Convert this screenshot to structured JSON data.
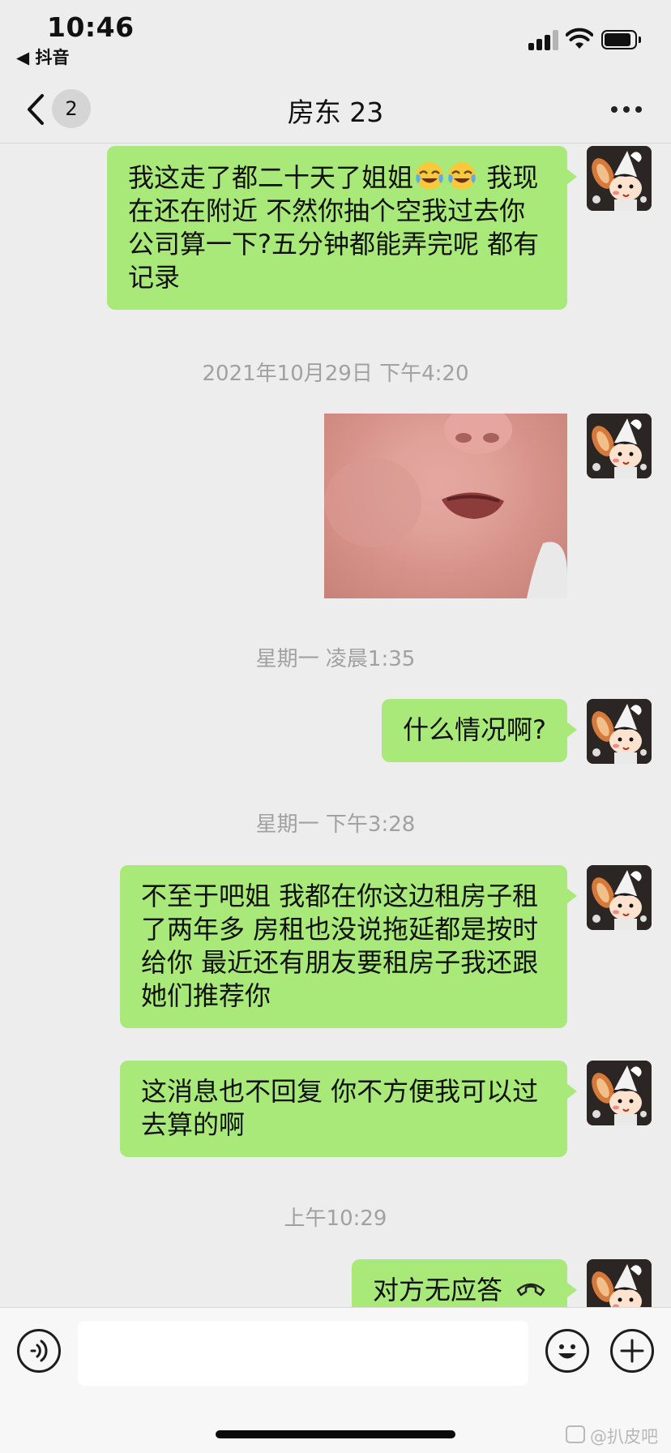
{
  "status_bar": {
    "time": "10:46",
    "back_app": "◀ 抖音"
  },
  "nav": {
    "back_count": "2",
    "title": "房东 23"
  },
  "messages": [
    {
      "text_before": "我这走了都二十天了姐姐",
      "emoji": "face-with-tears-of-joy",
      "text_after": " 我现在还在附近  不然你抽个空我过去你公司算一下?五分钟都能弄完呢   都有记录"
    },
    {
      "timestamp": "2021年10月29日 下午4:20"
    },
    {
      "image": "baby-face-photo"
    },
    {
      "timestamp": "星期一 凌晨1:35"
    },
    {
      "text": "什么情况啊?"
    },
    {
      "timestamp": "星期一 下午3:28"
    },
    {
      "text": "不至于吧姐  我都在你这边租房子租了两年多  房租也没说拖延都是按时给你  最近还有朋友要租房子我还跟她们推荐你"
    },
    {
      "text": "这消息也不回复  你不方便我可以过去算的啊"
    },
    {
      "timestamp": "上午10:29"
    },
    {
      "call_text": "对方无应答",
      "icon": "phone-hangup-icon"
    }
  ],
  "input_bar": {
    "placeholder": ""
  },
  "watermark": "@扒皮吧",
  "colors": {
    "bubble": "#a9e97a",
    "background": "#ededed",
    "timestamp": "#a1a1a1"
  }
}
